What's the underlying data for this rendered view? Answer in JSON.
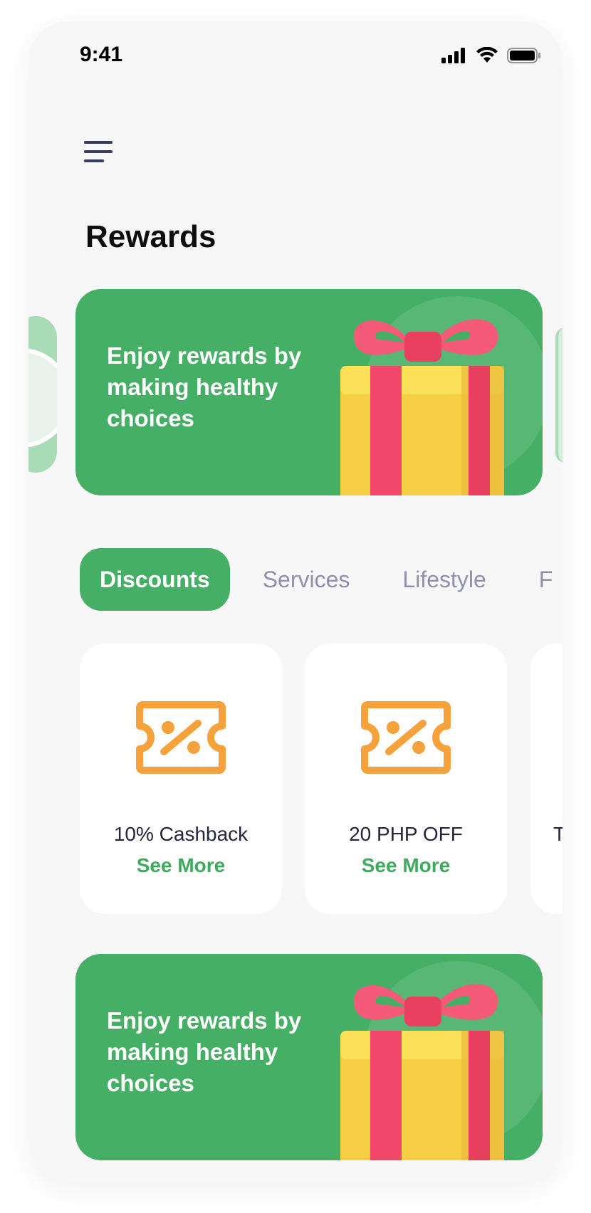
{
  "status": {
    "time": "9:41"
  },
  "header": {
    "title": "Rewards"
  },
  "banners": [
    {
      "text": "Enjoy rewards by making healthy choices"
    },
    {
      "text": "Enjoy rewards by making healthy choices"
    }
  ],
  "tabs": [
    {
      "label": "Discounts",
      "active": true
    },
    {
      "label": "Services"
    },
    {
      "label": "Lifestyle"
    },
    {
      "label": "F"
    }
  ],
  "cards": [
    {
      "title": "10% Cashback",
      "link": "See More"
    },
    {
      "title": "20 PHP OFF",
      "link": "See More"
    },
    {
      "title": "T"
    }
  ],
  "colors": {
    "accent": "#46af66",
    "coupon": "#f5a13c",
    "background": "#f7f7f7"
  }
}
